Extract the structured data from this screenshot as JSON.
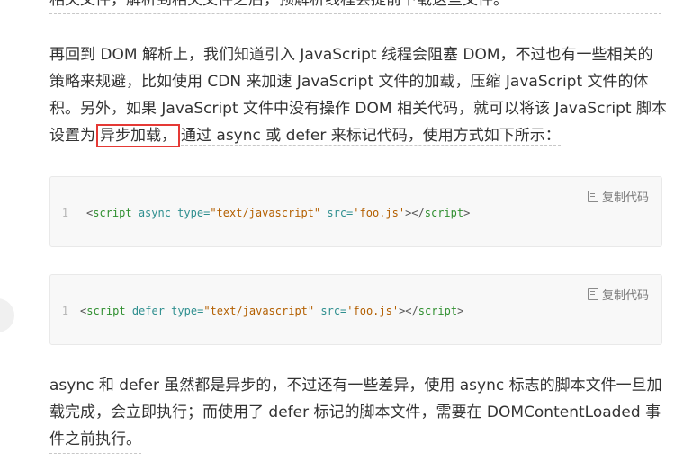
{
  "paragraphs": {
    "top_cut": "相关文件，解析到相关文件之后，预解析线程会提前下载这些文件。",
    "dom": {
      "line1": "再回到 DOM 解析上，我们知道引入 JavaScript 线程会阻塞 DOM，不过也有一些相关的",
      "line2": "策略来规避，比如使用 CDN 来加速 JavaScript 文件的加载，压缩 JavaScript 文件的体",
      "line3": "积。另外，如果 JavaScript 文件中没有操作 DOM 相关代码，就可以将该 JavaScript 脚本",
      "line4_before": "设置为",
      "line4_highlight": "异步加载，",
      "line4_after": "通过 async 或 defer 来标记代码，使用方式如下所示："
    },
    "async": {
      "line1": "async 和 defer 虽然都是异步的，不过还有一些差异，使用 async 标志的脚本文件一旦加",
      "line2": "载完成，会立即执行；而使用了 defer 标记的脚本文件，需要在 DOMContentLoaded 事",
      "line3": "件之前执行。"
    }
  },
  "code_blocks": [
    {
      "copy_label": "复制代码",
      "line_number": "1",
      "tokens": {
        "open": "<script",
        "attr1": " async",
        "attr2": " type=",
        "val2": "\"text/javascript\"",
        "attr3": " src=",
        "val3": "'foo.js'",
        "close": "></",
        "endtag": "script",
        "end": ">"
      }
    },
    {
      "copy_label": "复制代码",
      "line_number": "1",
      "tokens": {
        "open": "<script",
        "attr1": " defer",
        "attr2": " type=",
        "val2": "\"text/javascript\"",
        "attr3": " src=",
        "val3": "'foo.js'",
        "close": "></",
        "endtag": "script",
        "end": ">"
      }
    }
  ],
  "colors": {
    "highlight_border": "#e53935",
    "code_background": "#f8f8f8"
  }
}
